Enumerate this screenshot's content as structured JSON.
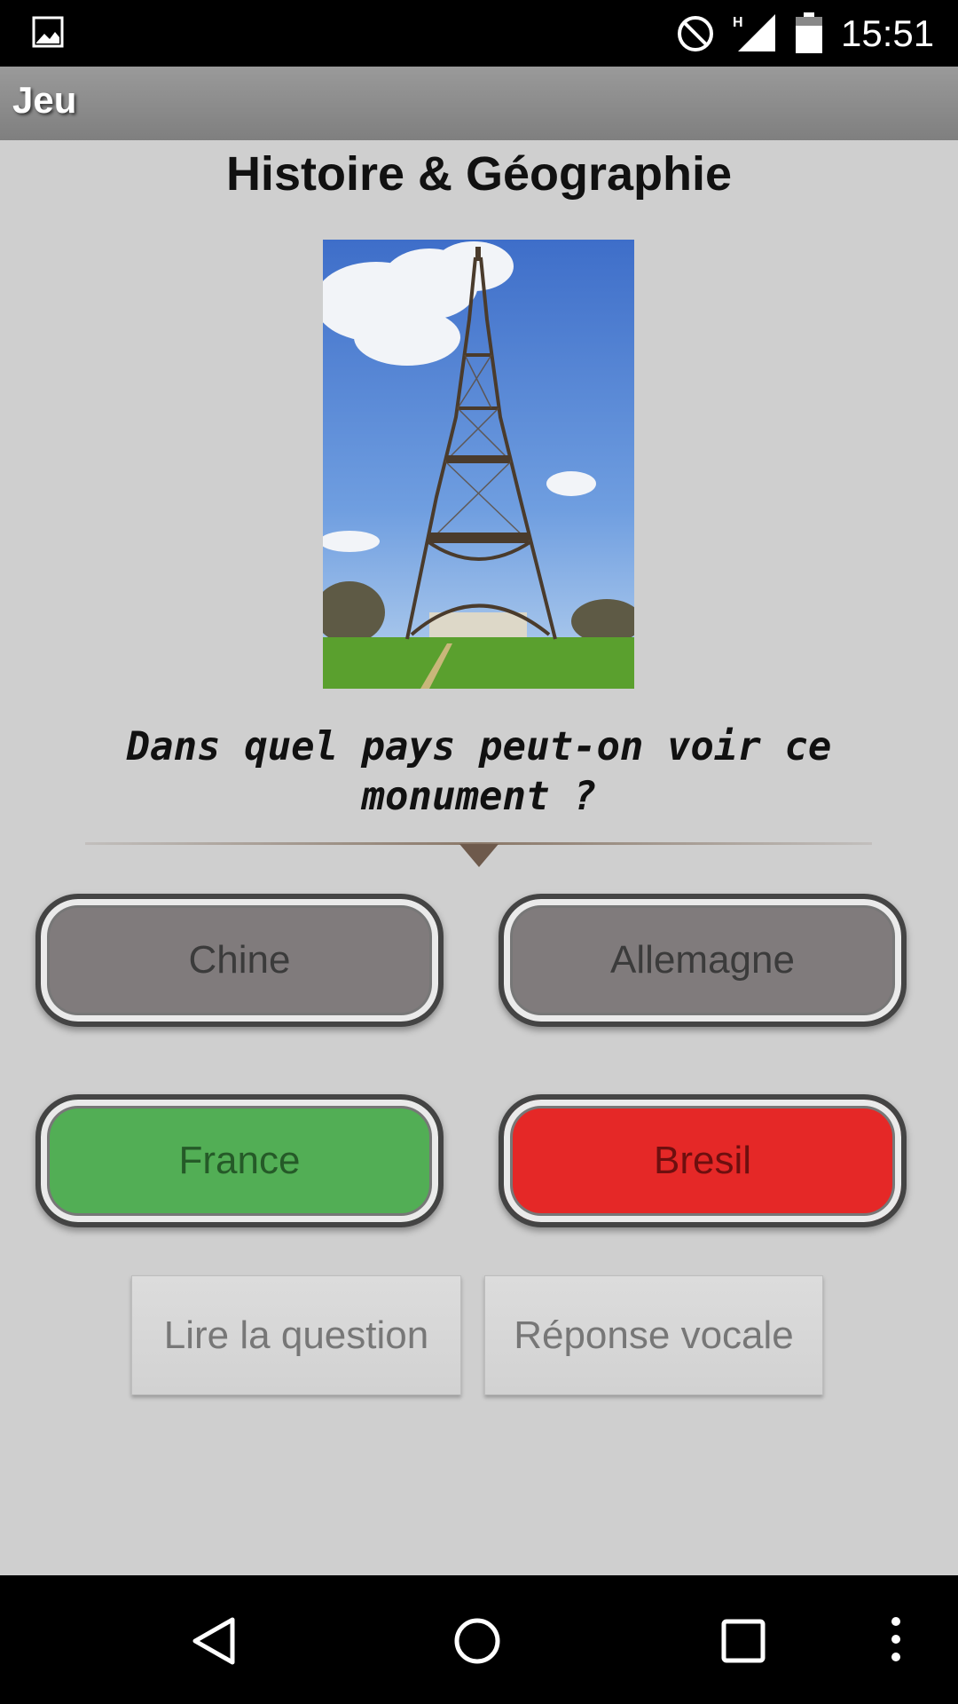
{
  "status_bar": {
    "time": "15:51",
    "network_letter": "H",
    "icons": [
      "gallery-icon",
      "do-not-disturb-icon",
      "signal-icon",
      "battery-icon"
    ]
  },
  "action_bar": {
    "title": "Jeu"
  },
  "quiz": {
    "category": "Histoire & Géographie",
    "image_subject": "eiffel-tower-photo",
    "question": "Dans quel pays peut-on voir ce monument ?",
    "answers": [
      {
        "label": "Chine",
        "state": "neutral"
      },
      {
        "label": "Allemagne",
        "state": "neutral"
      },
      {
        "label": "France",
        "state": "correct"
      },
      {
        "label": "Bresil",
        "state": "wrong"
      }
    ]
  },
  "actions": {
    "read_question": "Lire la question",
    "voice_answer": "Réponse vocale"
  },
  "colors": {
    "correct": "#52ae55",
    "wrong": "#e52827",
    "neutral": "#807b7c",
    "background": "#cfcfcf"
  },
  "nav_bar": {
    "icons": [
      "back-icon",
      "home-icon",
      "recent-apps-icon",
      "overflow-menu-icon"
    ]
  }
}
